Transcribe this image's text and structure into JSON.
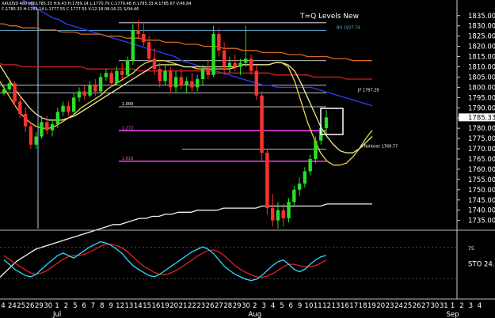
{
  "header": {
    "symbol": "XAUUSD 480 Min",
    "ohlc_line1": "C:1785.33 H:6.43 H:1789.14 L:1770.70 C:1779.46 H:1785.33 A:1785.67 V:46.84",
    "ohlc_line2": "C:1785.33 H:1789.14 L:1777.55 C:1777.55 V:12.18 08:16:21 5/04:46",
    "study_title": "T=Q Levels New"
  },
  "chart_data": {
    "type": "candlestick",
    "title": "T=Q Levels New",
    "y_axis": {
      "min": 1731,
      "max": 1838,
      "ticks": [
        1835,
        1830,
        1825,
        1820,
        1815,
        1810,
        1805,
        1800,
        1795,
        1790,
        1785,
        1780,
        1775,
        1770,
        1765,
        1760,
        1755,
        1750,
        1745,
        1740,
        1735
      ],
      "last_price": 1785.33
    },
    "x_axis": {
      "day_ticks": [
        "4",
        "24",
        "25",
        "26",
        "29",
        "30",
        "1",
        "2",
        "5",
        "6",
        "7",
        "8",
        "9",
        "12",
        "13",
        "14",
        "15",
        "16",
        "19",
        "20",
        "21",
        "22",
        "23",
        "26",
        "27",
        "28",
        "29",
        "30",
        "2",
        "3",
        "4",
        "5",
        "6",
        "9",
        "10",
        "11",
        "12",
        "13",
        "16",
        "17",
        "18",
        "19",
        "20",
        "23",
        "24",
        "25",
        "26",
        "27",
        "30",
        "31",
        "1",
        "2",
        "3",
        "4"
      ],
      "month_labels": [
        {
          "label": "Jul",
          "index": 6
        },
        {
          "label": "Aug",
          "index": 28
        },
        {
          "label": "Sep",
          "index": 50
        }
      ]
    },
    "levels": [
      {
        "label": "BO 1827.74",
        "value": 1827.74,
        "color": "#5fb0d8"
      },
      {
        "label": "JF 1797.29",
        "value": 1797.29,
        "color": "#ffffff"
      },
      {
        "label": "0 Rollover 1769.77",
        "value": 1769.77,
        "color": "#ffffff"
      },
      {
        "label": "1.000",
        "value": 1790.5,
        "color": "#ffffff"
      },
      {
        "label": "1.272",
        "value": 1778.8,
        "color": "#ff4cff"
      },
      {
        "label": "1.618",
        "value": 1763.9,
        "color": "#ff4cff"
      },
      {
        "label": "",
        "value": 1813.0,
        "color": "#ffffff"
      },
      {
        "label": "",
        "value": 1801.0,
        "color": "#ffffff"
      },
      {
        "label": "",
        "value": 1831.5,
        "color": "#ffffff"
      }
    ],
    "candles": [
      [
        1797,
        1801,
        1796,
        1799
      ],
      [
        1799,
        1803,
        1798,
        1802
      ],
      [
        1802,
        1803,
        1791,
        1793
      ],
      [
        1793,
        1796,
        1785,
        1787
      ],
      [
        1787,
        1790,
        1778,
        1781
      ],
      [
        1781,
        1783,
        1770,
        1772
      ],
      [
        1772,
        1778,
        1770,
        1776
      ],
      [
        1776,
        1786,
        1775,
        1783
      ],
      [
        1783,
        1786,
        1777,
        1779
      ],
      [
        1779,
        1784,
        1776,
        1782
      ],
      [
        1782,
        1790,
        1780,
        1788
      ],
      [
        1788,
        1793,
        1786,
        1791
      ],
      [
        1791,
        1793,
        1786,
        1788
      ],
      [
        1788,
        1797,
        1787,
        1795
      ],
      [
        1795,
        1800,
        1793,
        1798
      ],
      [
        1798,
        1801,
        1794,
        1796
      ],
      [
        1796,
        1803,
        1795,
        1801
      ],
      [
        1801,
        1804,
        1796,
        1798
      ],
      [
        1798,
        1807,
        1797,
        1805
      ],
      [
        1805,
        1809,
        1803,
        1807
      ],
      [
        1807,
        1808,
        1800,
        1802
      ],
      [
        1802,
        1810,
        1801,
        1808
      ],
      [
        1808,
        1812,
        1804,
        1806
      ],
      [
        1806,
        1815,
        1805,
        1813
      ],
      [
        1813,
        1831,
        1811,
        1828
      ],
      [
        1828,
        1833,
        1824,
        1826
      ],
      [
        1826,
        1832,
        1820,
        1822
      ],
      [
        1822,
        1825,
        1812,
        1814
      ],
      [
        1814,
        1819,
        1806,
        1809
      ],
      [
        1809,
        1812,
        1800,
        1803
      ],
      [
        1803,
        1811,
        1801,
        1808
      ],
      [
        1808,
        1810,
        1797,
        1800
      ],
      [
        1800,
        1808,
        1797,
        1805
      ],
      [
        1805,
        1809,
        1799,
        1801
      ],
      [
        1801,
        1805,
        1797,
        1803
      ],
      [
        1803,
        1807,
        1798,
        1800
      ],
      [
        1800,
        1806,
        1798,
        1804
      ],
      [
        1804,
        1811,
        1801,
        1809
      ],
      [
        1809,
        1813,
        1804,
        1806
      ],
      [
        1806,
        1830,
        1805,
        1826
      ],
      [
        1826,
        1829,
        1815,
        1818
      ],
      [
        1818,
        1822,
        1806,
        1810
      ],
      [
        1810,
        1815,
        1807,
        1812
      ],
      [
        1812,
        1816,
        1808,
        1810
      ],
      [
        1810,
        1814,
        1806,
        1812
      ],
      [
        1812,
        1830,
        1810,
        1814
      ],
      [
        1814,
        1816,
        1806,
        1808
      ],
      [
        1808,
        1811,
        1794,
        1796
      ],
      [
        1796,
        1798,
        1764,
        1768
      ],
      [
        1768,
        1770,
        1738,
        1741
      ],
      [
        1741,
        1748,
        1732,
        1735
      ],
      [
        1735,
        1744,
        1731,
        1740
      ],
      [
        1740,
        1743,
        1732,
        1736
      ],
      [
        1736,
        1746,
        1734,
        1744
      ],
      [
        1744,
        1752,
        1742,
        1750
      ],
      [
        1750,
        1756,
        1747,
        1753
      ],
      [
        1753,
        1761,
        1751,
        1759
      ],
      [
        1759,
        1767,
        1757,
        1765
      ],
      [
        1765,
        1776,
        1763,
        1774
      ],
      [
        1774,
        1782,
        1772,
        1780
      ],
      [
        1780,
        1789,
        1777,
        1785.33
      ]
    ],
    "moving_averages": [
      {
        "color": "#2e3fff",
        "values": [
          1851,
          1850,
          1849,
          1848,
          1846,
          1844,
          1842,
          1840,
          1838,
          1836,
          1834,
          1833,
          1831,
          1830,
          1829,
          1828,
          1827,
          1826,
          1825,
          1824,
          1823,
          1822,
          1821,
          1820,
          1819,
          1818,
          1817,
          1816,
          1815,
          1813,
          1812,
          1811,
          1810,
          1809,
          1808,
          1807,
          1806,
          1805,
          1804,
          1803,
          1802,
          1801,
          1801,
          1800,
          1800,
          1800,
          1800,
          1800,
          1800,
          1799,
          1798,
          1797,
          1796,
          1795,
          1794,
          1793,
          1792,
          1791
        ]
      },
      {
        "color": "#d42020",
        "values": [
          1812,
          1812,
          1812,
          1811,
          1811,
          1811,
          1810,
          1810,
          1810,
          1810,
          1810,
          1810,
          1810,
          1810,
          1810,
          1810,
          1809,
          1809,
          1809,
          1809,
          1809,
          1809,
          1809,
          1809,
          1808,
          1808,
          1808,
          1808,
          1808,
          1808,
          1808,
          1808,
          1808,
          1808,
          1808,
          1808,
          1807,
          1807,
          1807,
          1807,
          1807,
          1807,
          1807,
          1807,
          1807,
          1806,
          1806,
          1806,
          1806,
          1806,
          1806,
          1805,
          1805,
          1805,
          1805,
          1805,
          1804,
          1804,
          1804,
          1804,
          1804
        ]
      },
      {
        "color": "#d46a20",
        "values": [
          1832,
          1832,
          1831,
          1831,
          1830,
          1830,
          1829,
          1829,
          1829,
          1828,
          1828,
          1828,
          1827,
          1827,
          1827,
          1826,
          1826,
          1826,
          1826,
          1825,
          1825,
          1825,
          1824,
          1824,
          1824,
          1823,
          1823,
          1823,
          1822,
          1822,
          1822,
          1821,
          1821,
          1821,
          1820,
          1820,
          1820,
          1819,
          1819,
          1819,
          1818,
          1818,
          1818,
          1817,
          1817,
          1817,
          1817,
          1816,
          1816,
          1816,
          1815,
          1815,
          1815,
          1815,
          1814,
          1814,
          1814,
          1813,
          1813,
          1813,
          1813
        ]
      },
      {
        "color": "#e8d84a",
        "values": [
          1815,
          1810,
          1805,
          1800,
          1795,
          1790,
          1786,
          1783,
          1781,
          1780,
          1780,
          1781,
          1783,
          1785,
          1787,
          1790,
          1792,
          1794,
          1796,
          1799,
          1801,
          1803,
          1805,
          1807,
          1810,
          1812,
          1813,
          1813,
          1813,
          1812,
          1811,
          1810,
          1810,
          1809,
          1809,
          1809,
          1809,
          1809,
          1809,
          1810,
          1811,
          1811,
          1811,
          1811,
          1811,
          1812,
          1812,
          1810,
          1803,
          1793,
          1783,
          1775,
          1768,
          1764,
          1762,
          1762,
          1763,
          1766,
          1770,
          1775,
          1779
        ]
      },
      {
        "color": "#f0ec9a",
        "values": [
          1822,
          1818,
          1813,
          1808,
          1803,
          1798,
          1794,
          1790,
          1787,
          1785,
          1784,
          1784,
          1784,
          1785,
          1786,
          1788,
          1790,
          1792,
          1794,
          1796,
          1798,
          1800,
          1802,
          1804,
          1806,
          1808,
          1810,
          1811,
          1811,
          1811,
          1811,
          1810,
          1810,
          1810,
          1810,
          1810,
          1810,
          1810,
          1810,
          1810,
          1811,
          1811,
          1811,
          1811,
          1811,
          1812,
          1812,
          1811,
          1808,
          1802,
          1795,
          1788,
          1781,
          1776,
          1772,
          1769,
          1768,
          1768,
          1770,
          1773,
          1776
        ]
      },
      {
        "color": "#f2f2f2",
        "values": [
          1700,
          1703,
          1706,
          1709,
          1712,
          1715,
          1717,
          1719,
          1721,
          1722,
          1723,
          1724,
          1725,
          1726,
          1727,
          1728,
          1729,
          1730,
          1731,
          1732,
          1733,
          1733,
          1734,
          1735,
          1736,
          1736,
          1737,
          1737,
          1738,
          1738,
          1739,
          1739,
          1739,
          1740,
          1740,
          1740,
          1740,
          1741,
          1741,
          1741,
          1741,
          1741,
          1741,
          1742,
          1742,
          1742,
          1742,
          1742,
          1742,
          1742,
          1742,
          1742,
          1742,
          1743,
          1743,
          1743,
          1743,
          1743,
          1743,
          1743,
          1743
        ]
      }
    ],
    "oscillator": {
      "label": "STO",
      "value_label": "24.",
      "ticks": [
        "75",
        ""
      ],
      "k": [
        55,
        48,
        40,
        35,
        30,
        28,
        32,
        40,
        48,
        55,
        62,
        66,
        62,
        58,
        64,
        70,
        76,
        80,
        84,
        82,
        78,
        72,
        65,
        55,
        46,
        40,
        35,
        30,
        28,
        32,
        38,
        44,
        50,
        56,
        62,
        68,
        72,
        76,
        72,
        65,
        55,
        45,
        38,
        32,
        28,
        24,
        22,
        24,
        30,
        38,
        46,
        52,
        55,
        48,
        40,
        36,
        40,
        48,
        55,
        60,
        62
      ],
      "d": [
        62,
        56,
        50,
        44,
        39,
        34,
        32,
        34,
        38,
        44,
        50,
        56,
        60,
        62,
        62,
        64,
        68,
        72,
        77,
        80,
        80,
        78,
        74,
        68,
        60,
        52,
        45,
        40,
        35,
        32,
        31,
        34,
        38,
        43,
        49,
        55,
        61,
        66,
        70,
        71,
        68,
        62,
        54,
        46,
        40,
        35,
        31,
        28,
        27,
        29,
        33,
        38,
        44,
        48,
        48,
        46,
        44,
        44,
        46,
        50,
        55
      ]
    }
  }
}
